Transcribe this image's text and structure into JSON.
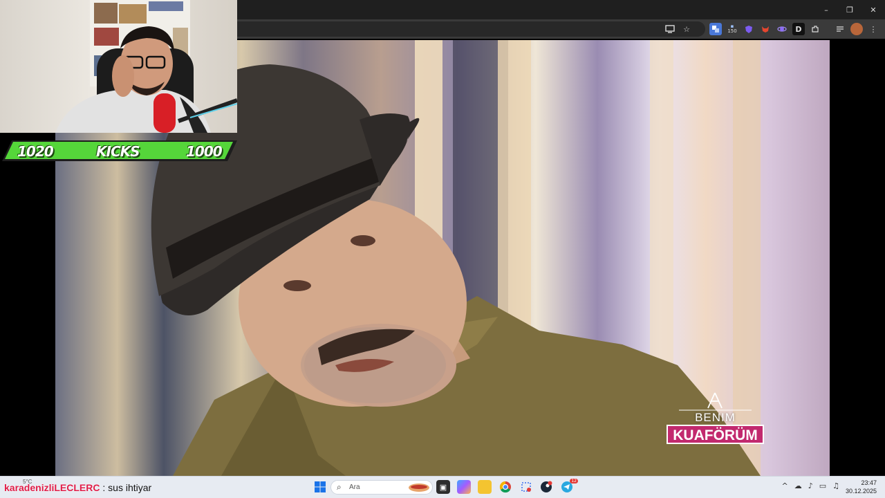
{
  "window": {
    "minimize_glyph": "–",
    "restore_glyph": "❐",
    "close_glyph": "✕"
  },
  "browser": {
    "extension_badge": "150",
    "extension_letter": "D"
  },
  "video": {
    "logo_top": "BENIM",
    "logo_main": "KUAFÖRÜM"
  },
  "overlay": {
    "score_left": "1020",
    "score_label": "KICKS",
    "score_right": "1000"
  },
  "chat": {
    "username": "karadenizliLECLERC",
    "message": ": sus ihtiyar"
  },
  "taskbar": {
    "weather_temp": "5°C",
    "search_placeholder": "Ara",
    "time": "23:47",
    "date": "30.12.2025",
    "badge_count": "12"
  },
  "colors": {
    "kicks_green": "#55d63a",
    "logo_pink": "#c2296e",
    "chat_user": "#e11d48"
  },
  "icons": [
    "minimize-icon",
    "restore-icon",
    "close-icon",
    "screen-share-icon",
    "bookmark-star-icon",
    "translate-icon",
    "extensions-icon",
    "menu-icon",
    "windows-start-icon",
    "search-icon",
    "chrome-icon",
    "wifi-icon",
    "volume-icon",
    "microphone-icon"
  ]
}
